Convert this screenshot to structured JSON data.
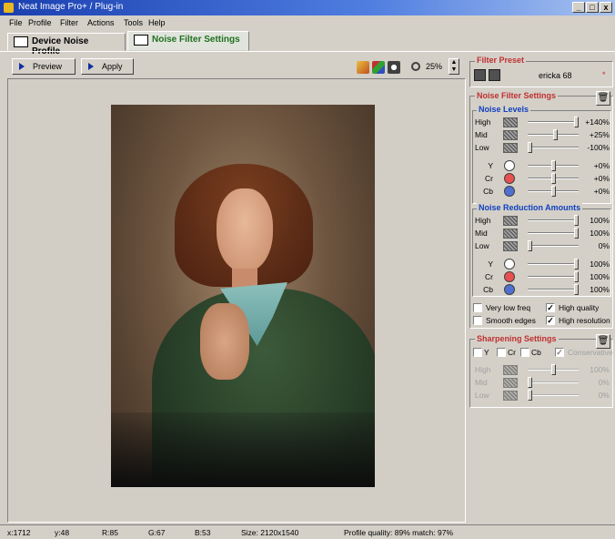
{
  "window": {
    "title": "Neat Image Pro+ / Plug-in",
    "minimize": "_",
    "restore": "□",
    "close": "x"
  },
  "menu": [
    "File",
    "Profile",
    "Filter",
    "Actions",
    "Tools",
    "Help"
  ],
  "tabs": [
    {
      "label": "Device Noise Profile"
    },
    {
      "label": "Noise Filter Settings"
    }
  ],
  "toolbar": {
    "preview_label": "Preview",
    "apply_label": "Apply",
    "zoom": "25%"
  },
  "filter_preset": {
    "title": "Filter Preset",
    "name": "ericka 68",
    "modified_mark": "*"
  },
  "noise_filter": {
    "title": "Noise Filter Settings",
    "noise_levels": {
      "title": "Noise Levels",
      "rows": [
        {
          "label": "High",
          "value": "+140%",
          "level": 1.0
        },
        {
          "label": "Mid",
          "value": "+25%",
          "level": 0.55
        },
        {
          "label": "Low",
          "value": "-100%",
          "level": 0.0
        },
        {
          "label": "Y",
          "value": "+0%",
          "level": 0.5,
          "color": "#ffffff"
        },
        {
          "label": "Cr",
          "value": "+0%",
          "level": 0.5,
          "color": "#e85050"
        },
        {
          "label": "Cb",
          "value": "+0%",
          "level": 0.5,
          "color": "#5070d0"
        }
      ]
    },
    "noise_reduction": {
      "title": "Noise Reduction Amounts",
      "rows": [
        {
          "label": "High",
          "value": "100%",
          "level": 1.0
        },
        {
          "label": "Mid",
          "value": "100%",
          "level": 1.0
        },
        {
          "label": "Low",
          "value": "0%",
          "level": 0.0
        },
        {
          "label": "Y",
          "value": "100%",
          "level": 1.0,
          "color": "#ffffff"
        },
        {
          "label": "Cr",
          "value": "100%",
          "level": 1.0,
          "color": "#e85050"
        },
        {
          "label": "Cb",
          "value": "100%",
          "level": 1.0,
          "color": "#5070d0"
        }
      ]
    },
    "options": [
      {
        "label": "Very low freq",
        "checked": false
      },
      {
        "label": "High quality",
        "checked": true
      },
      {
        "label": "Smooth edges",
        "checked": false
      },
      {
        "label": "High resolution",
        "checked": true
      }
    ]
  },
  "sharpening": {
    "title": "Sharpening Settings",
    "channels": [
      {
        "label": "Y"
      },
      {
        "label": "Cr"
      },
      {
        "label": "Cb"
      }
    ],
    "conservative": "Conservative",
    "rows": [
      {
        "label": "High",
        "value": "100%",
        "level": 0.5
      },
      {
        "label": "Mid",
        "value": "0%",
        "level": 0.0
      },
      {
        "label": "Low",
        "value": "0%",
        "level": 0.0
      }
    ]
  },
  "status": {
    "x": "x:1712",
    "y": "y:48",
    "r": "R:85",
    "g": "G:67",
    "b": "B:53",
    "size": "Size: 2120x1540",
    "profile": "Profile quality: 89%  match: 97%"
  }
}
